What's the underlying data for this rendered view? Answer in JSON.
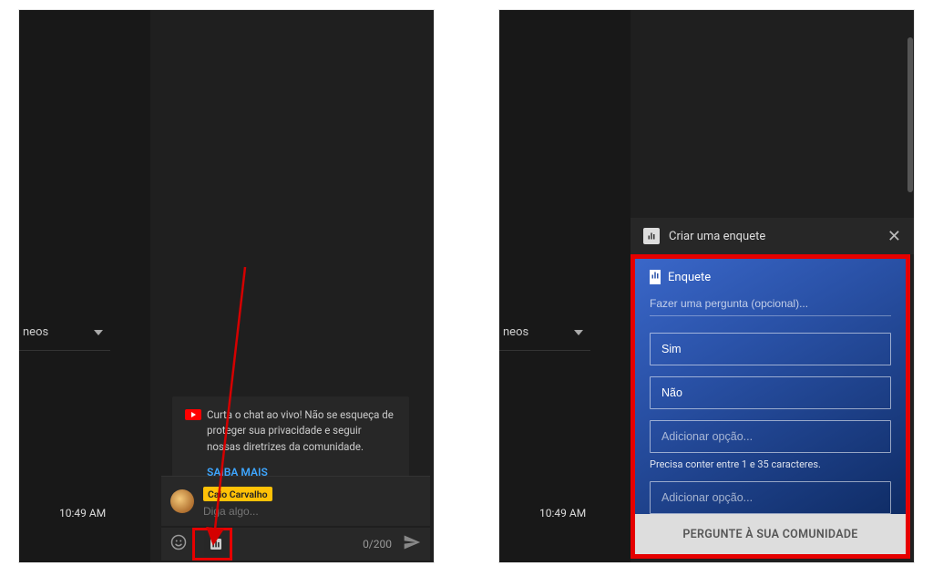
{
  "sidebar": {
    "item_label": "neos"
  },
  "timestamp": "10:49 AM",
  "system_message": {
    "text": "Curta o chat ao vivo! Não se esqueça de proteger sua privacidade e seguir nossas diretrizes da comunidade.",
    "learn_more": "SAIBA MAIS"
  },
  "chat": {
    "username": "Caio Carvalho",
    "placeholder": "Diga algo...",
    "char_count": "0/200"
  },
  "poll_header": {
    "title": "Criar uma enquete"
  },
  "poll_form": {
    "badge": "Enquete",
    "question_placeholder": "Fazer uma pergunta (opcional)...",
    "option1": "Sim",
    "option2": "Não",
    "add_option_placeholder": "Adicionar opção...",
    "hint": "Precisa conter entre 1 e 35 caracteres.",
    "submit": "PERGUNTE À SUA COMUNIDADE"
  }
}
